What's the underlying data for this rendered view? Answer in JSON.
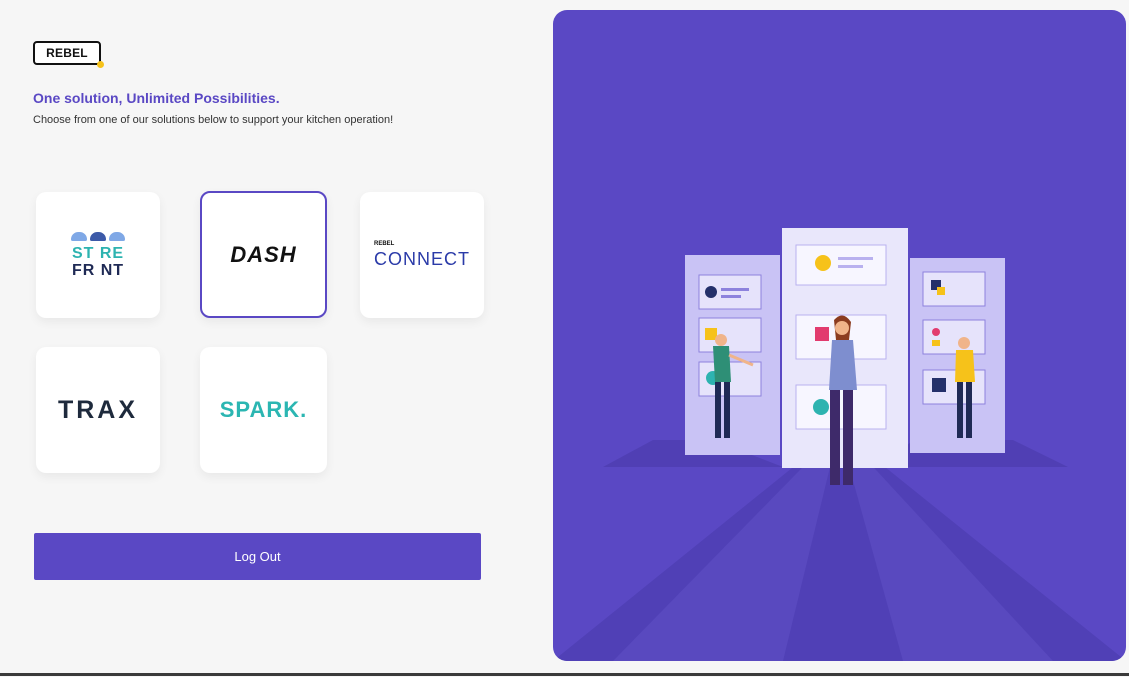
{
  "brand": {
    "logo_text": "REBEL"
  },
  "intro": {
    "headline": "One solution, Unlimited Possibilities.",
    "subtext": "Choose from one of our solutions below to support your kitchen operation!"
  },
  "solutions": [
    {
      "name": "STORE FRONT",
      "line1": "ST RE",
      "line2": "FR NT",
      "selected": false
    },
    {
      "name": "DASH",
      "text": "DASH",
      "selected": true
    },
    {
      "name": "REBEL CONNECT",
      "prefix": "REBEL",
      "text": "CONNECT",
      "selected": false
    },
    {
      "name": "TRAX",
      "text": "TRAX",
      "selected": false
    },
    {
      "name": "SPARK.",
      "text": "SPARK.",
      "selected": false
    }
  ],
  "actions": {
    "logout_label": "Log Out"
  },
  "colors": {
    "accent": "#5a48c4",
    "teal": "#2db3b0",
    "yellow": "#f6c21a",
    "page_bg": "#f6f6f6"
  }
}
